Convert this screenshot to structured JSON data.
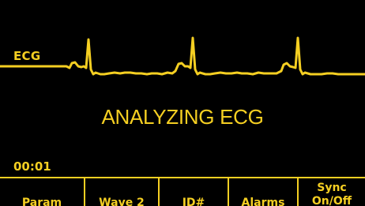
{
  "ecg_label": "ECG",
  "status_message": "ANALYZING ECG",
  "elapsed_time": "00:01",
  "softkeys": [
    {
      "label": "Param"
    },
    {
      "label": "Wave 2"
    },
    {
      "label": "ID#"
    },
    {
      "label": "Alarms"
    },
    {
      "label_line1": "Sync",
      "label_line2": "On/Off"
    }
  ],
  "colors": {
    "background": "#000000",
    "foreground": "#f5cf22"
  },
  "icons": [
    "ecg-waveform-trace"
  ]
}
